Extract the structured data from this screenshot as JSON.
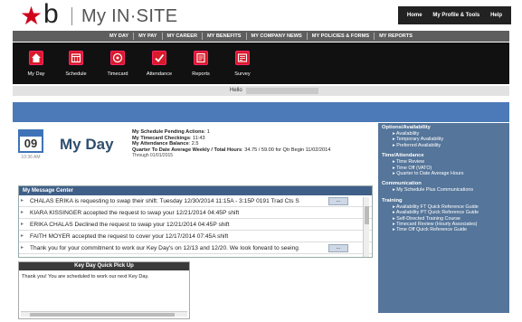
{
  "header": {
    "brand_star": "★",
    "brand_letter": "b",
    "site_name": "My IN·SITE",
    "util_nav": [
      "Home",
      "My Profile & Tools",
      "Help"
    ]
  },
  "main_nav": [
    "MY DAY",
    "MY PAY",
    "MY CAREER",
    "MY BENEFITS",
    "MY COMPANY NEWS",
    "MY POLICIES & FORMS",
    "MY REPORTS"
  ],
  "toolbar": [
    {
      "label": "My Day",
      "icon": "home-icon"
    },
    {
      "label": "Schedule",
      "icon": "schedule-icon"
    },
    {
      "label": "Timecard",
      "icon": "timecard-icon"
    },
    {
      "label": "Attendance",
      "icon": "attendance-icon"
    },
    {
      "label": "Reports",
      "icon": "reports-icon"
    },
    {
      "label": "Survey",
      "icon": "survey-icon"
    }
  ],
  "hello": {
    "label": "Hello"
  },
  "myday": {
    "title": "My Day",
    "calendar_day": "09",
    "calendar_time": "10:36 AM",
    "summary": {
      "line1_label": "My Schedule Pending Actions",
      "line1_value": "1",
      "line2_label": "My Timecard Checkings",
      "line2_value": "11:43",
      "line3_label": "My Attendance Balance",
      "line3_value": "2.5",
      "line4_label": "Quarter To Date Average Weekly / Total Hours",
      "line4_value": "34.75 / 59.00 for Qtr Begin 11/02/2014",
      "line5": "Through 01/01/2015"
    }
  },
  "message_center": {
    "title": "My Message Center",
    "button_label": "...",
    "messages": [
      {
        "text": "CHALAS ERIKA is requesting to swap their shift: Tuesday 12/30/2014 11:15A - 3:15P 0191 Trad Cts S",
        "button": true
      },
      {
        "text": "KIARA KISSINGER accepted the request to swap your 12/21/2014 04:45P shift",
        "button": false
      },
      {
        "text": "ERIKA CHALAS Declined the request to swap your 12/21/2014 04:45P shift",
        "button": false
      },
      {
        "text": "FAITH MOYER accepted the request to cover your 12/17/2014 07:45A shift",
        "button": false
      },
      {
        "text": "Thank you for your commitment to work our Key Day's on 12/13 and 12/20. We look forward to seeing",
        "button": true
      }
    ]
  },
  "keyday": {
    "title": "Key Day Quick Pick Up",
    "body": "Thank you! You are scheduled to work our next Key Day."
  },
  "sidebar": [
    {
      "title": "Options/Availability",
      "items": [
        "Availability",
        "Temporary Availability",
        "Preferred Availability"
      ]
    },
    {
      "title": "Time/Attendance",
      "items": [
        "Time Review",
        "Time Off (VATO)",
        "Quarter to Date Average Hours"
      ]
    },
    {
      "title": "Communication",
      "items": [
        "My Schedule Plus Communications"
      ]
    },
    {
      "title": "Training",
      "items": [
        "Availability FT Quick Reference Guide",
        "Availability PT Quick Reference Guide",
        "Self-Directed Training Course",
        "Timecard Review (Hourly Associates)",
        "Time Off Quick Reference Guide"
      ]
    }
  ],
  "colors": {
    "brand_red": "#d0021b",
    "nav_blue": "#4c7ab8",
    "sidebar_blue": "#55759a",
    "toolbar_black": "#111111"
  }
}
